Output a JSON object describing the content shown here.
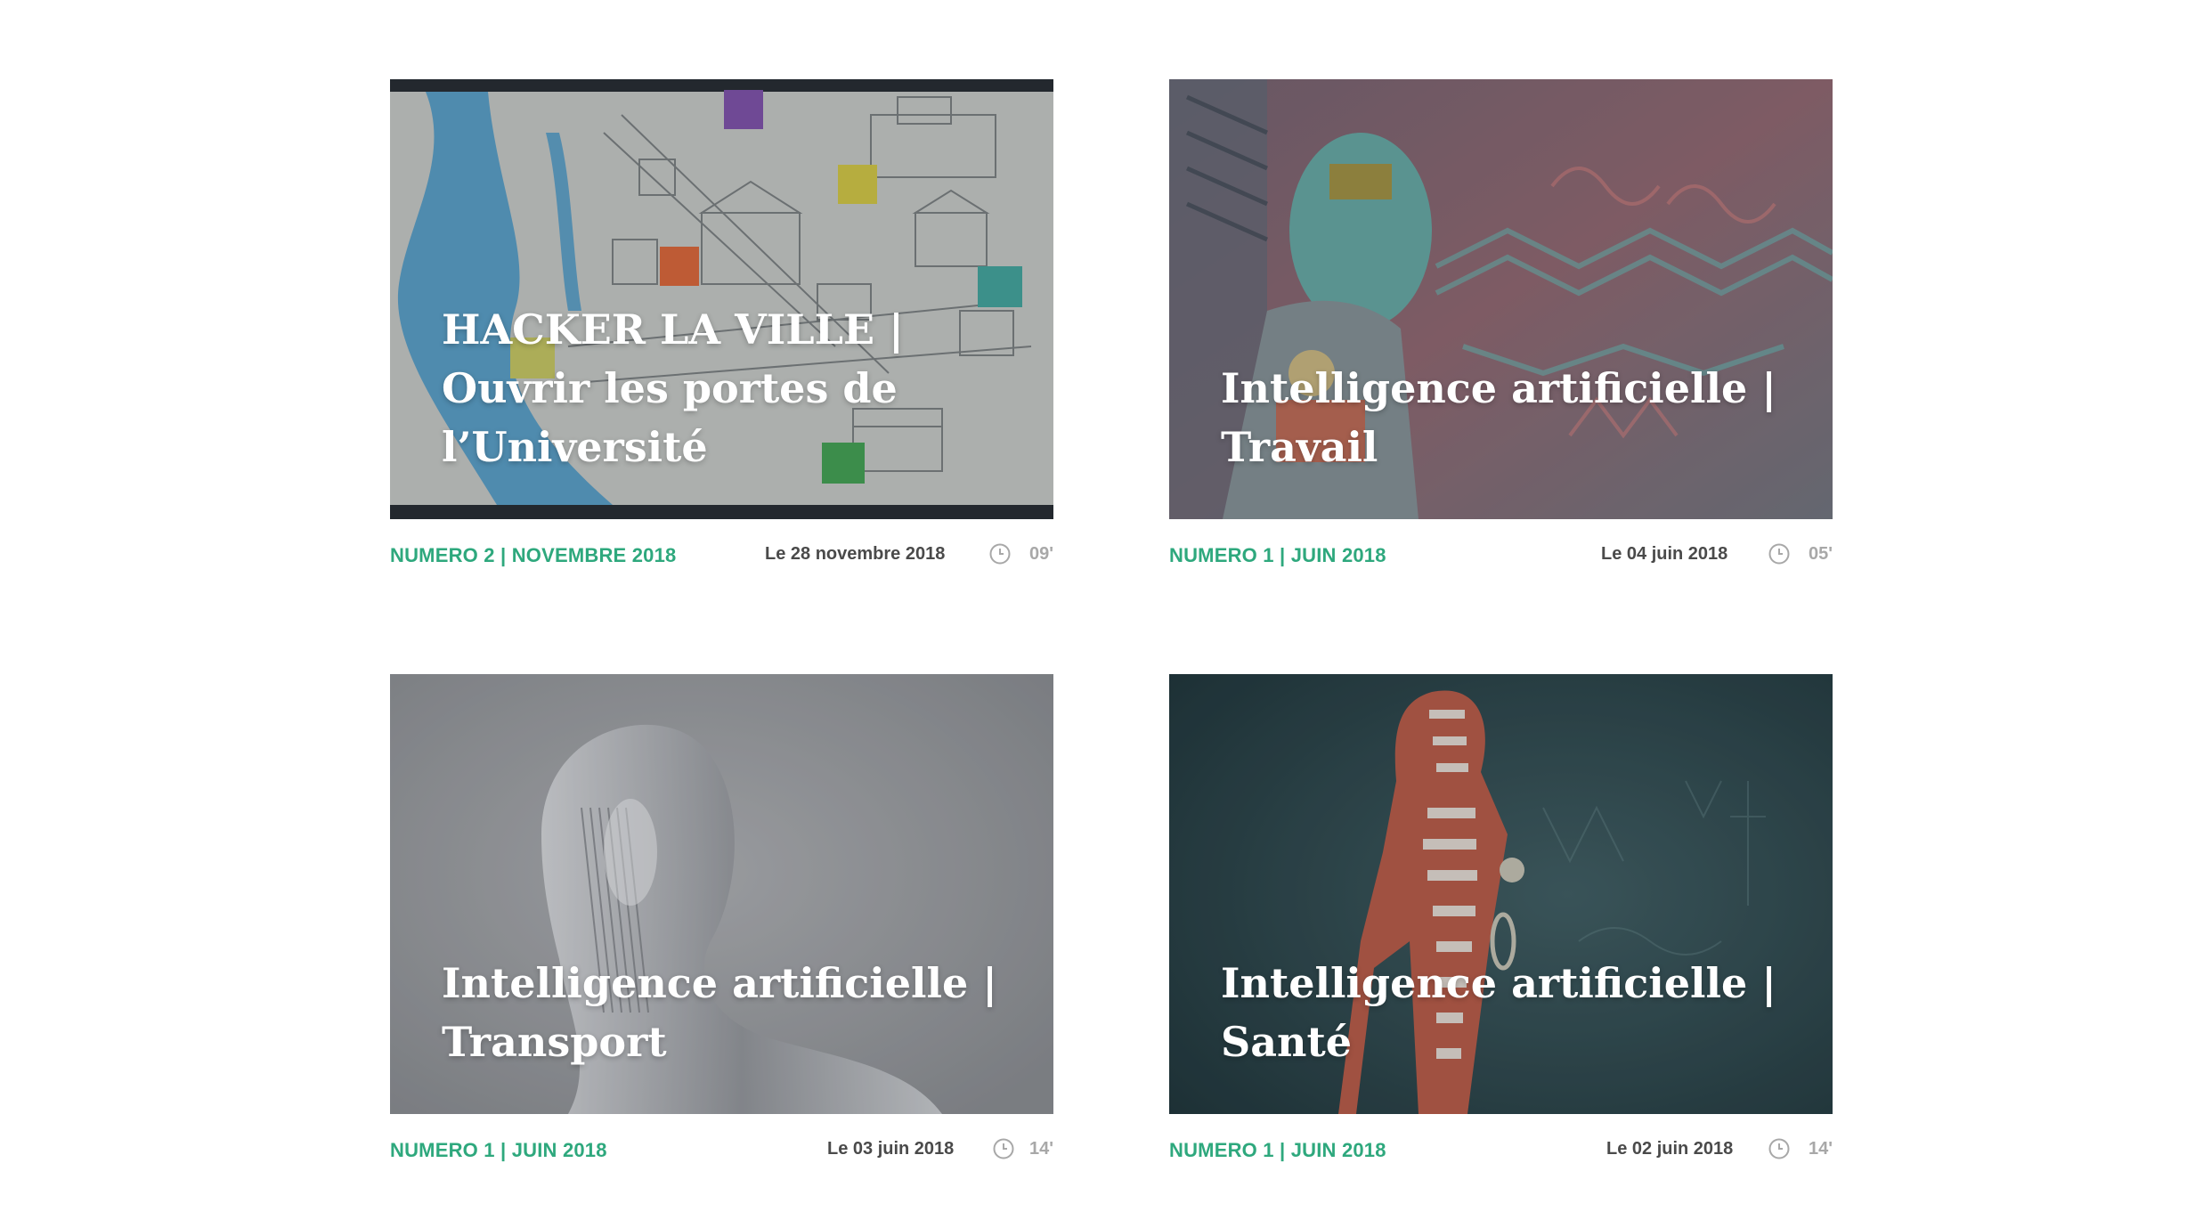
{
  "cards": [
    {
      "title": "HACKER LA VILLE | Ouvrir les portes de l’Université",
      "issue": "NUMERO 2 | NOVEMBRE 2018",
      "date": "Le 28 novembre 2018",
      "duration": "09'"
    },
    {
      "title": "Intelligence artificielle | Travail",
      "issue": "NUMERO 1 | JUIN 2018",
      "date": "Le 04 juin 2018",
      "duration": "05'"
    },
    {
      "title": "Intelligence artificielle | Transport",
      "issue": "NUMERO 1 | JUIN 2018",
      "date": "Le 03 juin 2018",
      "duration": "14'"
    },
    {
      "title": "Intelligence artificielle | Santé",
      "issue": "NUMERO 1 | JUIN 2018",
      "date": "Le 02 juin 2018",
      "duration": "14'"
    }
  ],
  "icons": {
    "duration": "clock-icon"
  },
  "colors": {
    "issue": "#2ea87d",
    "date": "#4a4a4a",
    "duration": "#a8a8a8"
  }
}
